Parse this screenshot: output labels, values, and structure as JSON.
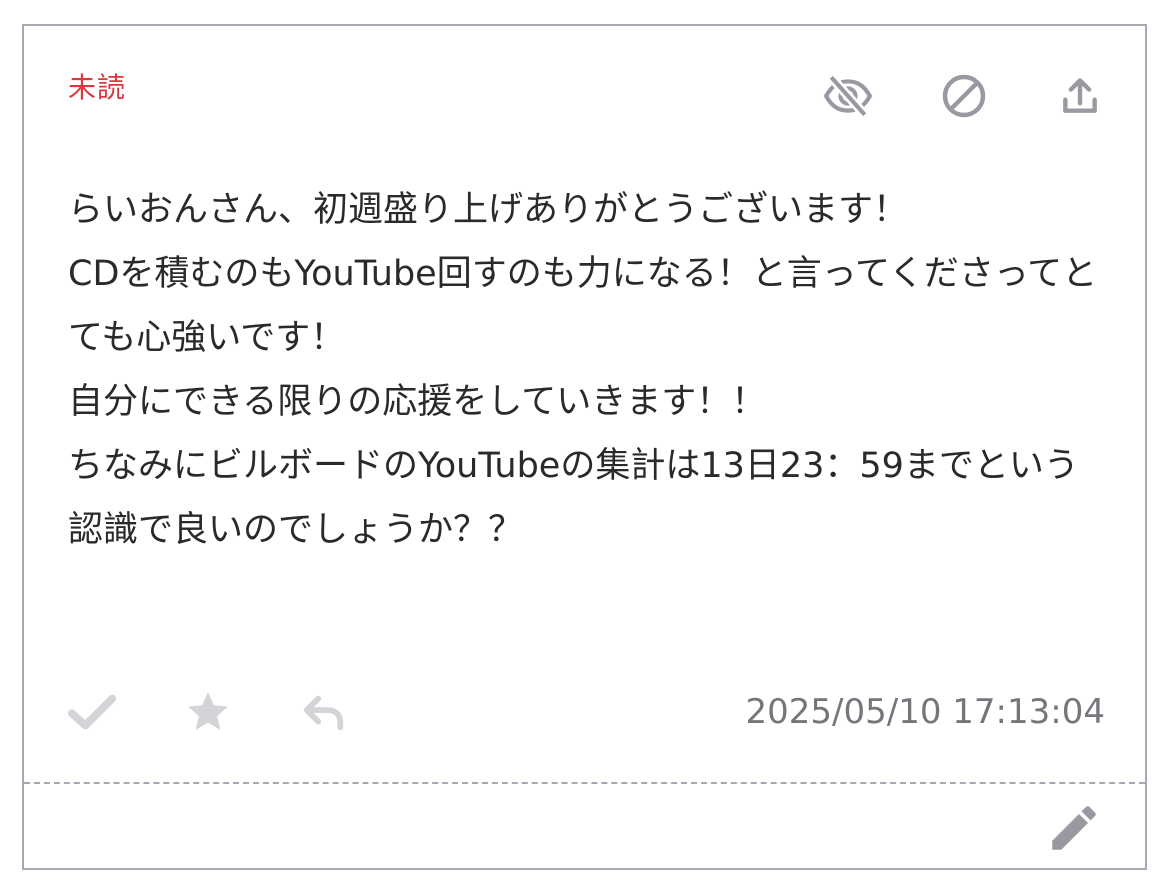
{
  "card": {
    "status_label": "未読",
    "message": "らいおんさん、初週盛り上げありがとうございます！\nCDを積むのもYouTube回すのも力になる！と言ってくださってとても心強いです！\n自分にできる限りの応援をしていきます！！\nちなみにビルボードのYouTubeの集計は13日23：59までという認識で良いのでしょうか？？",
    "timestamp": "2025/05/10 17:13:04"
  },
  "icons": {
    "top": [
      "eye-slash-icon",
      "block-icon",
      "share-upload-icon"
    ],
    "bottom": [
      "checkmark-icon",
      "star-icon",
      "reply-icon"
    ],
    "footer": [
      "pencil-edit-icon"
    ]
  },
  "colors": {
    "status": "#d9383e",
    "border": "#a9a8b2",
    "icon_dark": "#9a99a2",
    "icon_light": "#d4d4d8",
    "text": "#2a2a2a",
    "timestamp": "#76757c"
  }
}
